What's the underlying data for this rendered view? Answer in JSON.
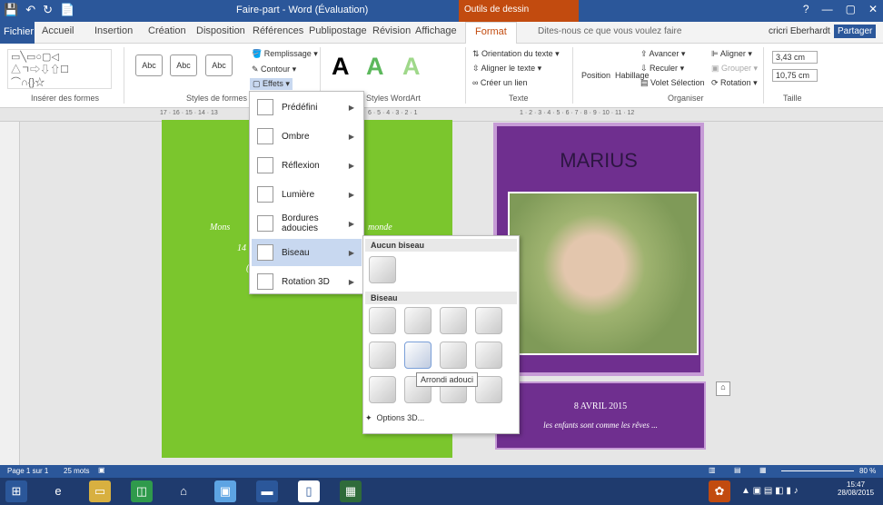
{
  "title_bar": {
    "qat_save": "💾",
    "qat_undo": "↶",
    "qat_redo": "↻",
    "qat_new": "📄",
    "title": "Faire-part - Word (Évaluation)",
    "context_tab": "Outils de dessin",
    "win_min": "—",
    "win_max": "▢",
    "win_close": "✕",
    "help": "?"
  },
  "tabs": {
    "file": "Fichier",
    "home": "Accueil",
    "insert": "Insertion",
    "creation": "Création",
    "layout": "Disposition",
    "refs": "Références",
    "mailings": "Publipostage",
    "review": "Révision",
    "view": "Affichage",
    "format": "Format",
    "tellme": "Dites-nous ce que vous voulez faire",
    "user": "cricri Eberhardt",
    "share": "Partager"
  },
  "ribbon": {
    "group_insert_shapes": "Insérer des formes",
    "group_shape_styles": "Styles de formes",
    "group_wordart": "Styles WordArt",
    "group_text": "Texte",
    "group_arrange": "Organiser",
    "group_size": "Taille",
    "abc": "Abc",
    "fill": "Remplissage",
    "outline": "Contour",
    "effects": "Effets",
    "bigA": "A",
    "text_direction": "Orientation du texte",
    "align_text": "Aligner le texte",
    "create_link": "Créer un lien",
    "position": "Position",
    "wrap": "Habillage",
    "forward": "Avancer",
    "backward": "Reculer",
    "selection_pane": "Volet Sélection",
    "align": "Aligner",
    "group": "Grouper",
    "rotate": "Rotation",
    "height": "3,43 cm",
    "width": "10,75 cm"
  },
  "ruler": {
    "ticks": "17 · 16 · 15 · 14 · 13",
    "ticks2": "6 · 5 · 4 · 3 · 2 · 1",
    "ticks3": "1 · 2 · 3 · 4 · 5 · 6 · 7 · 8 · 9 · 10 · 11 · 12"
  },
  "page1": {
    "line1": "Mons",
    "line1b": "monde",
    "line2": "14",
    "line3": "("
  },
  "card": {
    "name": "MARIUS",
    "date": "8 AVRIL 2015",
    "tagline": "les enfants sont comme les rêves ..."
  },
  "effects_menu": [
    {
      "label": "Prédéfini"
    },
    {
      "label": "Ombre"
    },
    {
      "label": "Réflexion"
    },
    {
      "label": "Lumière"
    },
    {
      "label": "Bordures adoucies"
    },
    {
      "label": "Biseau"
    },
    {
      "label": "Rotation 3D"
    }
  ],
  "bevel_menu": {
    "no_bevel": "Aucun biseau",
    "bevel": "Biseau",
    "tooltip": "Arrondi adouci",
    "options": "Options 3D..."
  },
  "status": {
    "page": "Page 1 sur 1",
    "words": "25 mots",
    "zoom": "80 %"
  },
  "taskbar": {
    "time": "15:47",
    "date": "28/08/2015"
  },
  "colors": {
    "word_blue": "#2b579a",
    "context_orange": "#c24b0f",
    "page_green": "#7bc62d",
    "card_purple": "#6f2f8f"
  }
}
